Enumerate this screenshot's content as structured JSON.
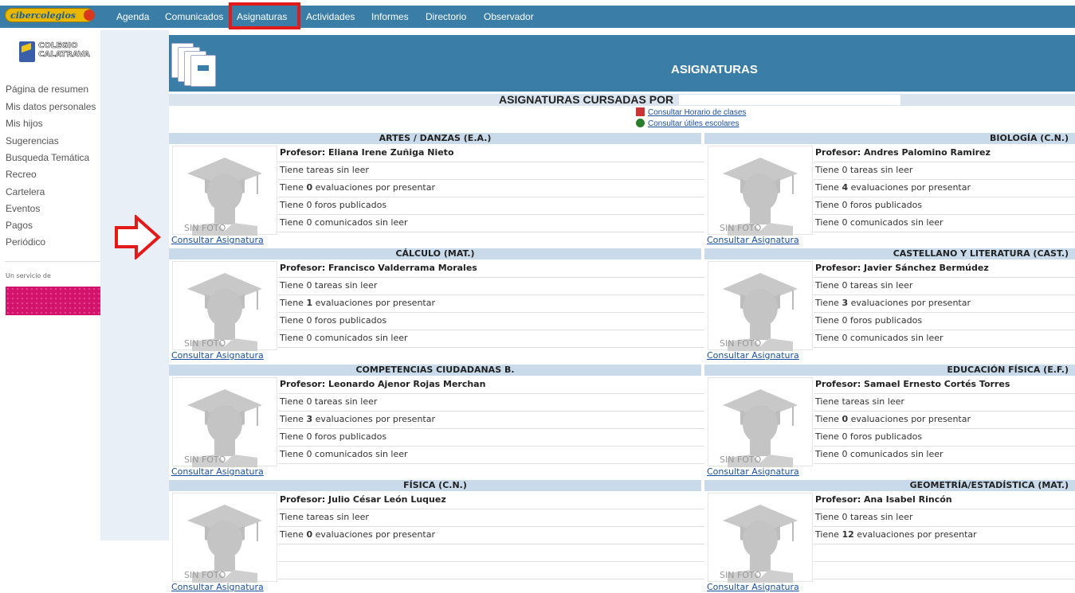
{
  "nav": {
    "logo": "cibercolegios",
    "items": [
      "Agenda",
      "Comunicados",
      "Asignaturas",
      "Actividades",
      "Informes",
      "Directorio",
      "Observador"
    ]
  },
  "sidebar": {
    "school": "COLEGIO CALATRAVA",
    "links": [
      "Página de resumen",
      "Mis datos personales",
      "Mis hijos",
      "Sugerencias",
      "Busqueda Temática",
      "Recreo",
      "Cartelera",
      "Eventos",
      "Pagos",
      "Periódico"
    ],
    "servicio": "Un servicio de"
  },
  "header": {
    "title": "ASIGNATURAS"
  },
  "cursadas": "ASIGNATURAS CURSADAS POR",
  "links": {
    "horario": "Consultar Horario de clases",
    "utiles": "Consultar útiles escolares"
  },
  "card_common": {
    "sin_foto": "SIN FOTO",
    "consultar": "Consultar Asignatura"
  },
  "cards": [
    {
      "title": "ARTES / DANZAS (E.A.)",
      "prof": "Profesor: Eliana Irene Zuñiga Nieto",
      "r1": "Tiene tareas sin leer",
      "r2a": "Tiene ",
      "r2n": "0",
      "r2b": " evaluaciones por presentar",
      "r3": "Tiene 0 foros publicados",
      "r4": "Tiene 0 comunicados sin leer"
    },
    {
      "title": "BIOLOGÍA (C.N.)",
      "prof": "Profesor: Andres Palomino Ramirez",
      "r1": "Tiene 0 tareas sin leer",
      "r2a": "Tiene ",
      "r2n": "4",
      "r2b": " evaluaciones por presentar",
      "r3": "Tiene 0 foros publicados",
      "r4": "Tiene 0 comunicados sin leer"
    },
    {
      "title": "CÁLCULO (MAT.)",
      "prof": "Profesor: Francisco Valderrama Morales",
      "r1": "Tiene 0 tareas sin leer",
      "r2a": "Tiene ",
      "r2n": "1",
      "r2b": " evaluaciones por presentar",
      "r3": "Tiene 0 foros publicados",
      "r4": "Tiene 0 comunicados sin leer"
    },
    {
      "title": "CASTELLANO Y LITERATURA (CAST.)",
      "prof": "Profesor: Javier Sánchez Bermúdez",
      "r1": "Tiene 0 tareas sin leer",
      "r2a": "Tiene ",
      "r2n": "3",
      "r2b": " evaluaciones por presentar",
      "r3": "Tiene 0 foros publicados",
      "r4": "Tiene 0 comunicados sin leer"
    },
    {
      "title": "COMPETENCIAS CIUDADANAS B.",
      "prof": "Profesor: Leonardo Ajenor Rojas Merchan",
      "r1": "Tiene 0 tareas sin leer",
      "r2a": "Tiene ",
      "r2n": "3",
      "r2b": " evaluaciones por presentar",
      "r3": "Tiene 0 foros publicados",
      "r4": "Tiene 0 comunicados sin leer"
    },
    {
      "title": "EDUCACIÓN FÍSICA (E.F.)",
      "prof": "Profesor: Samael Ernesto Cortés Torres",
      "r1": "Tiene tareas sin leer",
      "r2a": "Tiene ",
      "r2n": "0",
      "r2b": " evaluaciones por presentar",
      "r3": "Tiene 0 foros publicados",
      "r4": "Tiene 0 comunicados sin leer"
    },
    {
      "title": "FÍSICA (C.N.)",
      "prof": "Profesor: Julio César León Luquez",
      "r1": "Tiene tareas sin leer",
      "r2a": "Tiene ",
      "r2n": "0",
      "r2b": " evaluaciones por presentar",
      "r3": "",
      "r4": ""
    },
    {
      "title": "GEOMETRÍA/ESTADÍSTICA (MAT.)",
      "prof": "Profesor: Ana Isabel Rincón",
      "r1": "Tiene 0 tareas sin leer",
      "r2a": "Tiene ",
      "r2n": "12",
      "r2b": " evaluaciones por presentar",
      "r3": "",
      "r4": ""
    }
  ]
}
